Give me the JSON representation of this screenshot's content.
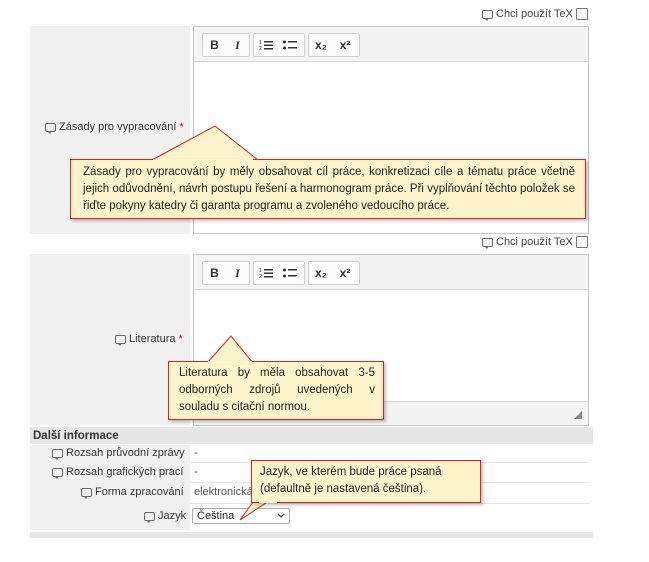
{
  "tex": {
    "label": "Chci použít TeX"
  },
  "editor": {
    "bold": "B",
    "italic": "I",
    "subscript": "x₂",
    "superscript": "x²"
  },
  "fields": {
    "zasady": {
      "label": "Zásady pro vypracování",
      "required_mark": "*"
    },
    "literatura": {
      "label": "Literatura",
      "required_mark": "*"
    }
  },
  "callouts": {
    "zasady": "Zásady pro vypracování by měly obsahovat cíl práce, konkretizaci cíle a tématu práce včetně jejich odůvodnění, návrh postupu řešení a harmonogram práce. Při vyplňování těchto položek se řiďte pokyny katedry či garanta programu a zvoleného vedoucího práce.",
    "literatura": "Literatura by měla obsahovat 3-5 odborných zdrojů uvedených v souladu s citační normou.",
    "jazyk": "Jazyk, ve kterém bude práce psaná (defaultně je nastavená čeština)."
  },
  "dalsi_informace": {
    "heading": "Další informace",
    "rows": [
      {
        "label": "Rozsah průvodní zprávy",
        "value": "-"
      },
      {
        "label": "Rozsah grafických prací",
        "value": "-"
      },
      {
        "label": "Forma zpracování",
        "value": "elektronická"
      }
    ],
    "jazyk": {
      "label": "Jazyk",
      "selected": "Čeština"
    }
  },
  "colors": {
    "callout_border": "#e0211c",
    "callout_bg": "#fdf4cc",
    "required": "#d0021b"
  }
}
